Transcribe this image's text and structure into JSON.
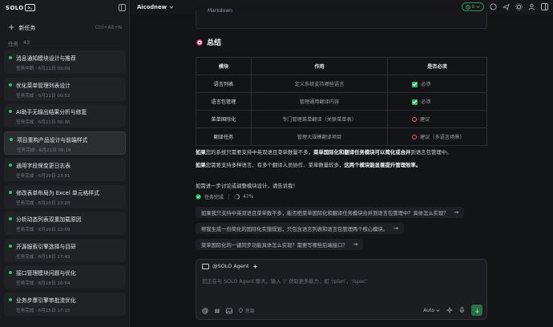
{
  "app": {
    "logo_text": "SOLO"
  },
  "sidebar": {
    "new_task_label": "新任务",
    "new_task_shortcut": "Ctrl+Alt+N",
    "tasks_label": "任务",
    "tasks_count": "43",
    "tasks": [
      {
        "title": "消息通知模块设计与推荐",
        "meta": "任务中断 · 6月21日 03:09",
        "active": false
      },
      {
        "title": "优化菜单管理列表设计",
        "meta": "任务完成 · 6月21日 00:52",
        "active": false
      },
      {
        "title": "AI助手无输出结果分析与修复",
        "meta": "任务完成 · 6月21日 00:36",
        "active": false
      },
      {
        "title": "项目重构产品设计与前端样式",
        "meta": "任务完成 · 6月21日 00:19",
        "active": true
      },
      {
        "title": "通用字段保变更日志表",
        "meta": "任务完成 · 6月20日 23:51",
        "active": false
      },
      {
        "title": "修改表单布局为 Excel 单元格样式",
        "meta": "任务完成 · 6月20日 23:20",
        "active": false
      },
      {
        "title": "分析动态列表双重加载原因",
        "meta": "任务完成 · 6月20日 22:09",
        "active": false
      },
      {
        "title": "开源服索引擎选择与目研",
        "meta": "任务完成 · 6月18日 17:45",
        "active": false
      },
      {
        "title": "接口管理模块问题与优化",
        "meta": "任务完成 · 6月18日 16:54",
        "active": false
      },
      {
        "title": "业务步骤引擎审批流优化",
        "meta": "任务完成 · 6月15日 17:15",
        "active": false
      }
    ]
  },
  "topbar": {
    "project_name": "Aicodnew",
    "version_label": "0"
  },
  "main": {
    "code_strip_text": "Markdown",
    "section_title": "总结",
    "table": {
      "headers": [
        "模块",
        "作用",
        "是否必须"
      ],
      "rows": [
        {
          "module": "语言列表",
          "purpose": "定义系统支持哪些语言",
          "required": "必须",
          "kind": "check"
        },
        {
          "module": "语言包管理",
          "purpose": "管理通用翻译内容",
          "required": "必须",
          "kind": "check"
        },
        {
          "module": "菜单国际化",
          "purpose": "专门管理菜单翻译（关联菜单表）",
          "required": "建议",
          "kind": "ring"
        },
        {
          "module": "翻译任务",
          "purpose": "管理大规模翻译项目",
          "required": "建议（多语言场景）",
          "kind": "ring"
        }
      ]
    },
    "para1": {
      "b1": "如果",
      "t1": "您的系统只需要支持中英双语且菜单数量不多，",
      "b2": "菜单国际化和翻译任务模块可以简化或合并",
      "t2": "到语言包管理中。"
    },
    "para2": {
      "b1": "如果",
      "t1": "您需要支持多种语言、有多个翻译人员协作、菜单数量较多，",
      "b2": "这两个模块能显著提升管理效率。"
    },
    "para3": "如需进一步讨论或调整模块设计，请告诉我！",
    "status": {
      "done_label": "任务完成",
      "progress": "47%"
    },
    "suggestions": [
      "如果我只支持中英双语且菜单数不多，能否把菜单国际化和翻译任务模块合并到语言包管理中？具体怎么实现？",
      "帮我生成一份简化的国际化实施规划，只包含语言列表和语言包管理两个核心模块。",
      "菜单国际化的一键同步功能具体怎么实现？需要写哪些后端接口？"
    ]
  },
  "composer": {
    "agent_label": "@SOLO Agent",
    "placeholder": "您正在与 SOLO Agent 聊天。输入 '/' 获取更多能力，如 '/plan'，'/spec'",
    "option_label": "思路",
    "model_label": "Auto"
  },
  "colors": {
    "accent_green": "#2fb568",
    "warn_red": "#f05d6c",
    "send_bg": "#2a6e47"
  }
}
